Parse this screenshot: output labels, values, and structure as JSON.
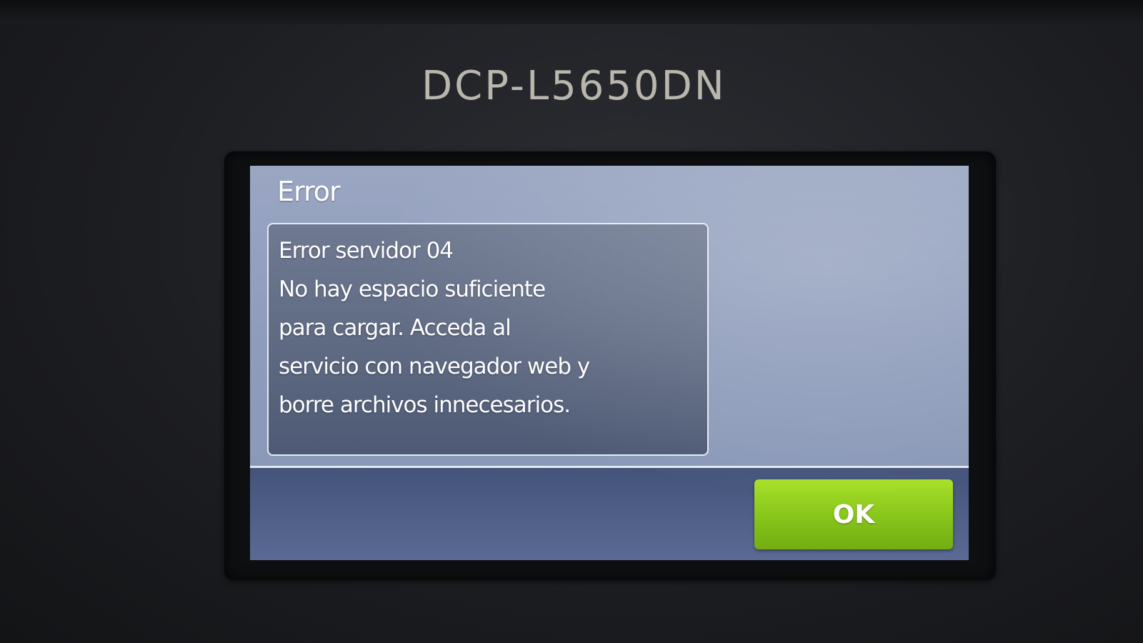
{
  "device": {
    "model": "DCP-L5650DN"
  },
  "dialog": {
    "title": "Error",
    "message_lines": [
      "Error servidor 04",
      "No hay espacio suficiente",
      "para cargar. Acceda al",
      "servicio con navegador web y",
      "borre archivos innecesarios."
    ],
    "ok_label": "OK"
  },
  "colors": {
    "screen_background": "#8e9cbb",
    "ok_button": "#84c219",
    "bezel": "#0e0f11"
  }
}
